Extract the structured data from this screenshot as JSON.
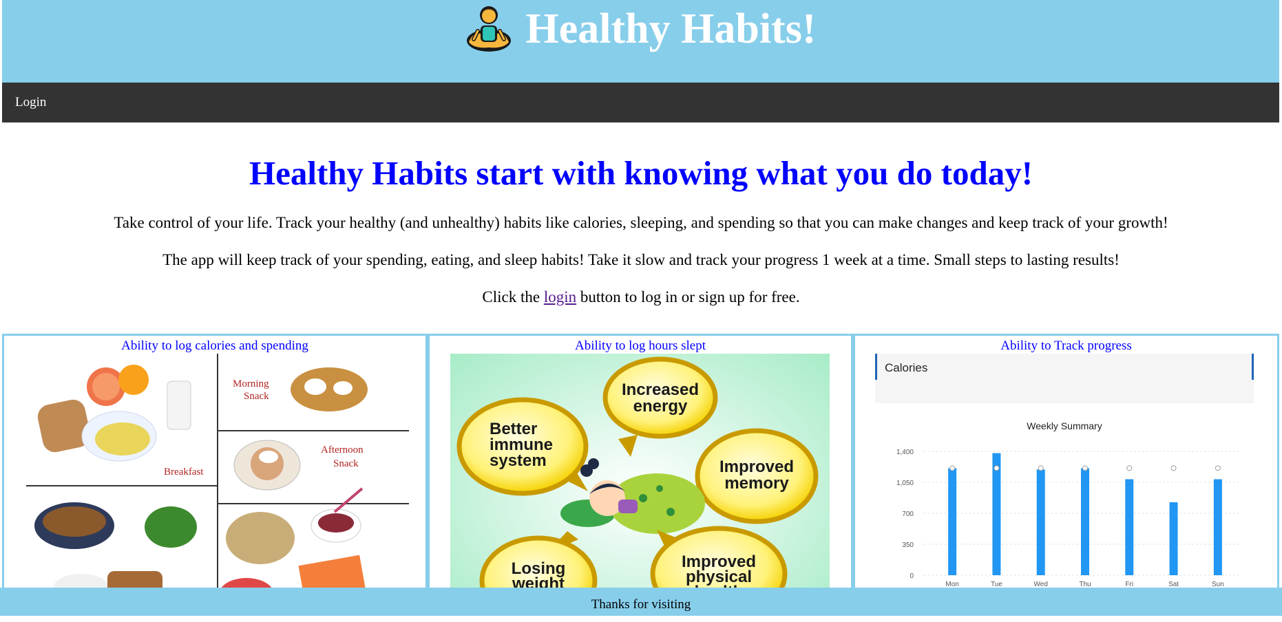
{
  "header": {
    "title": "Healthy Habits!",
    "logo_icon": "meditating-person-icon"
  },
  "nav": {
    "login_label": "Login"
  },
  "hero": {
    "title": "Healthy Habits start with knowing what you do today!",
    "p1": "Take control of your life. Track your healthy (and unhealthy) habits like calories, sleeping, and spending so that you can make changes and keep track of your growth!",
    "p2": "The app will keep track of your spending, eating, and sleep habits! Take it slow and track your progress 1 week at a time. Small steps to lasting results!",
    "p3_before": "Click the ",
    "p3_link": "login",
    "p3_after": " button to log in or sign up for free."
  },
  "cards": [
    {
      "title": "Ability to log calories and spending",
      "labels": {
        "morning": "Morning Snack",
        "breakfast": "Breakfast",
        "afternoon": "Afternoon Snack"
      }
    },
    {
      "title": "Ability to log hours slept",
      "bubbles": [
        "Increased energy",
        "Better immune system",
        "Improved memory",
        "Losing weight",
        "Improved physical health"
      ]
    },
    {
      "title": "Ability to Track progress",
      "panel_title": "Calories",
      "chart_title": "Weekly Summary"
    }
  ],
  "chart_data": {
    "type": "bar",
    "title": "Weekly Summary",
    "categories": [
      "Mon",
      "Tue",
      "Wed",
      "Thu",
      "Fri",
      "Sat",
      "Sun"
    ],
    "values": [
      1210,
      1380,
      1195,
      1210,
      1085,
      825,
      1085
    ],
    "goal_marker": [
      1210,
      1210,
      1210,
      1210,
      1210,
      1210,
      1210
    ],
    "yticks": [
      0,
      350,
      700,
      "1,050",
      "1,400"
    ],
    "ylim": [
      0,
      1400
    ],
    "grid": true,
    "bar_color": "#2196f3"
  },
  "footer": {
    "text": "Thanks for visiting"
  },
  "colors": {
    "header_bg": "#87ceeb",
    "nav_bg": "#333333",
    "accent": "#0000ff"
  }
}
